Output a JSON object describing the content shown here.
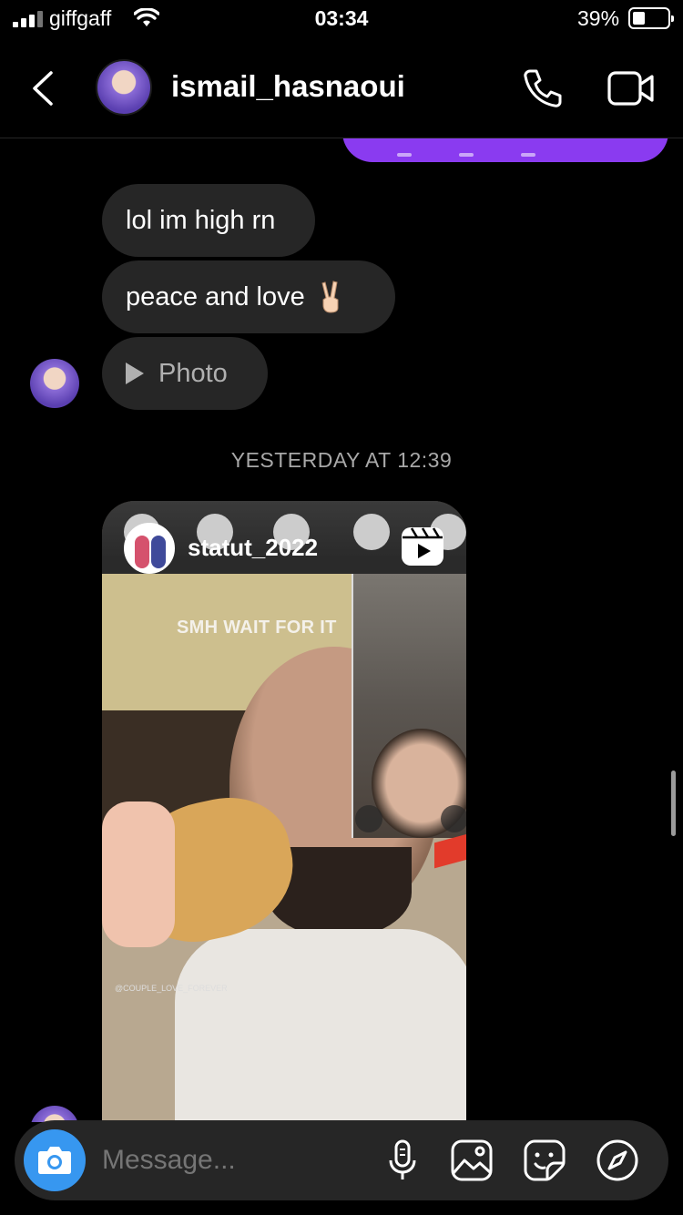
{
  "status_bar": {
    "carrier": "giffgaff",
    "time": "03:34",
    "battery_percent": "39%",
    "battery_level": 0.39
  },
  "header": {
    "username": "ismail_hasnaoui"
  },
  "messages": [
    {
      "text": "lol im high rn"
    },
    {
      "text": "peace and love"
    },
    {
      "text": "Photo"
    }
  ],
  "timestamp": "YESTERDAY AT 12:39",
  "shared_reel": {
    "owner": "statut_2022",
    "caption": "SMH WAIT FOR IT",
    "watermark": "@COUPLE_LOVE_FOREVER"
  },
  "composer": {
    "placeholder": "Message..."
  },
  "colors": {
    "sent_bubble": "#8a3bf0",
    "received_bubble": "#262626",
    "camera_button": "#3797f0",
    "background": "#000000"
  },
  "icons": [
    "back-chevron-icon",
    "phone-icon",
    "video-camera-icon",
    "play-icon",
    "reels-icon",
    "camera-icon",
    "microphone-icon",
    "gallery-icon",
    "sticker-icon",
    "compass-icon"
  ]
}
